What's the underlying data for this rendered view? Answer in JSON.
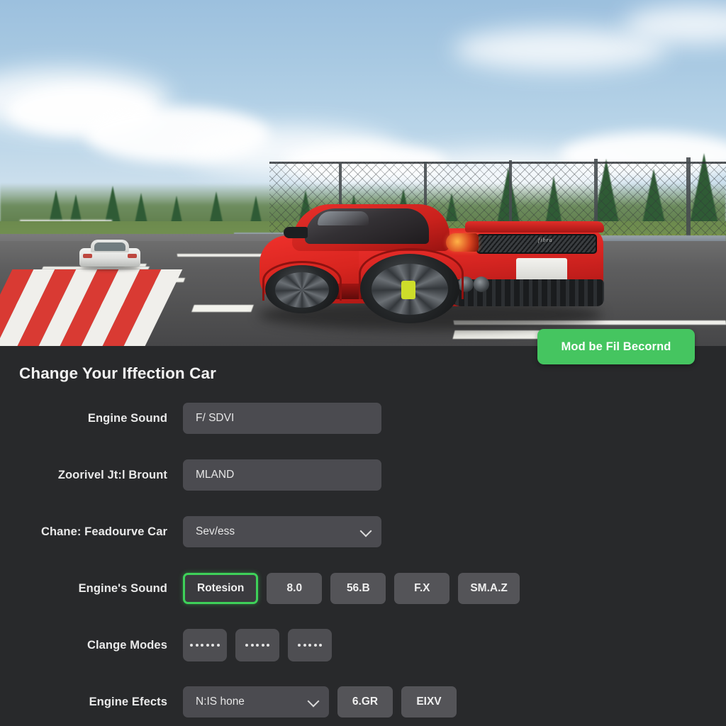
{
  "hero": {
    "alt": "red sports car rear view on race circuit",
    "car_badge": "fibra",
    "icons": {
      "red_car": "sports-car-icon",
      "white_car": "white-car-icon"
    }
  },
  "panel": {
    "title": "Change Your Iffection Car",
    "cta_label": "Mod be Fil Becornd",
    "accent_color": "#45c560",
    "selected_border_color": "#3ed159",
    "background_color": "#28292b",
    "field_color": "#4b4b50"
  },
  "rows": [
    {
      "label": "Engine Sound",
      "type": "text",
      "value": "F/ SDVI",
      "placeholder": "F/ SDVI"
    },
    {
      "label": "Zoorivel Jt:l Brount",
      "type": "text",
      "value": "MLAND",
      "placeholder": "MLAND"
    },
    {
      "label": "Chane: Feadourve Car",
      "type": "select",
      "value": "Sev/ess",
      "icon": "chevron-down-icon"
    },
    {
      "label": "Engine's Sound",
      "type": "chips",
      "chips": [
        {
          "label": "Rotesion",
          "selected": true
        },
        {
          "label": "8.0",
          "selected": false
        },
        {
          "label": "56.B",
          "selected": false
        },
        {
          "label": "F.X",
          "selected": false
        },
        {
          "label": "SM.A.Z",
          "selected": false
        }
      ]
    },
    {
      "label": "Clange Modes",
      "type": "dots",
      "dot_chips": [
        6,
        5,
        5
      ]
    },
    {
      "label": "Engine Efects",
      "type": "select_chips",
      "select_value": "N:IS hone",
      "select_icon": "chevron-down-icon",
      "chips": [
        {
          "label": "6.GR",
          "selected": false
        },
        {
          "label": "EIXV",
          "selected": false
        }
      ]
    }
  ]
}
